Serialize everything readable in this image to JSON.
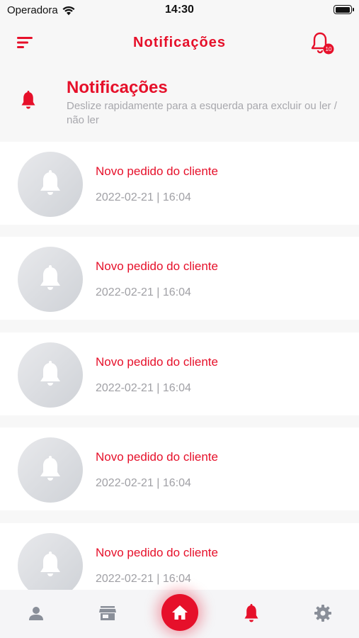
{
  "status_bar": {
    "carrier": "Operadora",
    "time": "14:30"
  },
  "top_bar": {
    "title": "Notificações",
    "badge": "10"
  },
  "header": {
    "title": "Notificações",
    "subtitle": "Deslize rapidamente para a esquerda para excluir ou ler / não ler"
  },
  "notifications": [
    {
      "title": "Novo pedido do cliente",
      "time": "2022-02-21 | 16:04"
    },
    {
      "title": "Novo pedido do cliente",
      "time": "2022-02-21 | 16:04"
    },
    {
      "title": "Novo pedido do cliente",
      "time": "2022-02-21 | 16:04"
    },
    {
      "title": "Novo pedido do cliente",
      "time": "2022-02-21 | 16:04"
    },
    {
      "title": "Novo pedido do cliente",
      "time": "2022-02-21 | 16:04"
    }
  ],
  "tab_bar": {
    "tabs": [
      "profile-icon",
      "store-icon",
      "home-icon",
      "bell-icon",
      "gear-icon"
    ],
    "active": "bell-icon"
  },
  "colors": {
    "accent": "#e6102a",
    "muted": "#a0a0a5",
    "inactive_icon": "#8a8f99",
    "background": "#f7f7f7"
  }
}
